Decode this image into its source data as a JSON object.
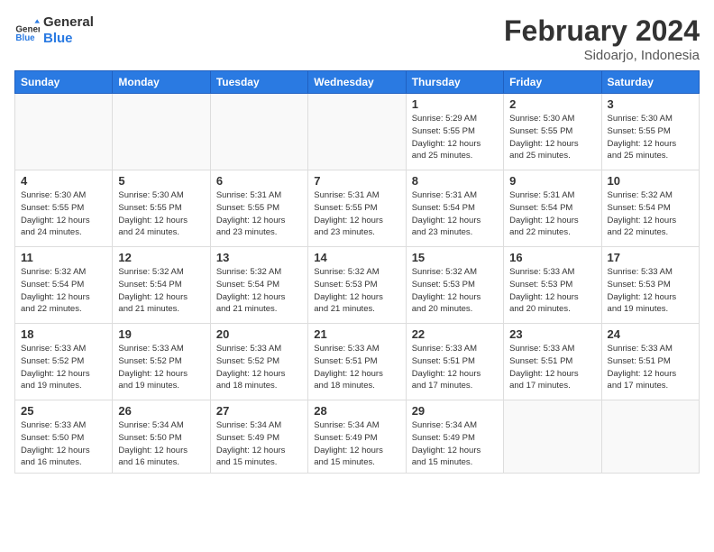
{
  "header": {
    "logo_line1": "General",
    "logo_line2": "Blue",
    "month_year": "February 2024",
    "location": "Sidoarjo, Indonesia"
  },
  "weekdays": [
    "Sunday",
    "Monday",
    "Tuesday",
    "Wednesday",
    "Thursday",
    "Friday",
    "Saturday"
  ],
  "weeks": [
    [
      {
        "day": "",
        "info": ""
      },
      {
        "day": "",
        "info": ""
      },
      {
        "day": "",
        "info": ""
      },
      {
        "day": "",
        "info": ""
      },
      {
        "day": "1",
        "info": "Sunrise: 5:29 AM\nSunset: 5:55 PM\nDaylight: 12 hours\nand 25 minutes."
      },
      {
        "day": "2",
        "info": "Sunrise: 5:30 AM\nSunset: 5:55 PM\nDaylight: 12 hours\nand 25 minutes."
      },
      {
        "day": "3",
        "info": "Sunrise: 5:30 AM\nSunset: 5:55 PM\nDaylight: 12 hours\nand 25 minutes."
      }
    ],
    [
      {
        "day": "4",
        "info": "Sunrise: 5:30 AM\nSunset: 5:55 PM\nDaylight: 12 hours\nand 24 minutes."
      },
      {
        "day": "5",
        "info": "Sunrise: 5:30 AM\nSunset: 5:55 PM\nDaylight: 12 hours\nand 24 minutes."
      },
      {
        "day": "6",
        "info": "Sunrise: 5:31 AM\nSunset: 5:55 PM\nDaylight: 12 hours\nand 23 minutes."
      },
      {
        "day": "7",
        "info": "Sunrise: 5:31 AM\nSunset: 5:55 PM\nDaylight: 12 hours\nand 23 minutes."
      },
      {
        "day": "8",
        "info": "Sunrise: 5:31 AM\nSunset: 5:54 PM\nDaylight: 12 hours\nand 23 minutes."
      },
      {
        "day": "9",
        "info": "Sunrise: 5:31 AM\nSunset: 5:54 PM\nDaylight: 12 hours\nand 22 minutes."
      },
      {
        "day": "10",
        "info": "Sunrise: 5:32 AM\nSunset: 5:54 PM\nDaylight: 12 hours\nand 22 minutes."
      }
    ],
    [
      {
        "day": "11",
        "info": "Sunrise: 5:32 AM\nSunset: 5:54 PM\nDaylight: 12 hours\nand 22 minutes."
      },
      {
        "day": "12",
        "info": "Sunrise: 5:32 AM\nSunset: 5:54 PM\nDaylight: 12 hours\nand 21 minutes."
      },
      {
        "day": "13",
        "info": "Sunrise: 5:32 AM\nSunset: 5:54 PM\nDaylight: 12 hours\nand 21 minutes."
      },
      {
        "day": "14",
        "info": "Sunrise: 5:32 AM\nSunset: 5:53 PM\nDaylight: 12 hours\nand 21 minutes."
      },
      {
        "day": "15",
        "info": "Sunrise: 5:32 AM\nSunset: 5:53 PM\nDaylight: 12 hours\nand 20 minutes."
      },
      {
        "day": "16",
        "info": "Sunrise: 5:33 AM\nSunset: 5:53 PM\nDaylight: 12 hours\nand 20 minutes."
      },
      {
        "day": "17",
        "info": "Sunrise: 5:33 AM\nSunset: 5:53 PM\nDaylight: 12 hours\nand 19 minutes."
      }
    ],
    [
      {
        "day": "18",
        "info": "Sunrise: 5:33 AM\nSunset: 5:52 PM\nDaylight: 12 hours\nand 19 minutes."
      },
      {
        "day": "19",
        "info": "Sunrise: 5:33 AM\nSunset: 5:52 PM\nDaylight: 12 hours\nand 19 minutes."
      },
      {
        "day": "20",
        "info": "Sunrise: 5:33 AM\nSunset: 5:52 PM\nDaylight: 12 hours\nand 18 minutes."
      },
      {
        "day": "21",
        "info": "Sunrise: 5:33 AM\nSunset: 5:51 PM\nDaylight: 12 hours\nand 18 minutes."
      },
      {
        "day": "22",
        "info": "Sunrise: 5:33 AM\nSunset: 5:51 PM\nDaylight: 12 hours\nand 17 minutes."
      },
      {
        "day": "23",
        "info": "Sunrise: 5:33 AM\nSunset: 5:51 PM\nDaylight: 12 hours\nand 17 minutes."
      },
      {
        "day": "24",
        "info": "Sunrise: 5:33 AM\nSunset: 5:51 PM\nDaylight: 12 hours\nand 17 minutes."
      }
    ],
    [
      {
        "day": "25",
        "info": "Sunrise: 5:33 AM\nSunset: 5:50 PM\nDaylight: 12 hours\nand 16 minutes."
      },
      {
        "day": "26",
        "info": "Sunrise: 5:34 AM\nSunset: 5:50 PM\nDaylight: 12 hours\nand 16 minutes."
      },
      {
        "day": "27",
        "info": "Sunrise: 5:34 AM\nSunset: 5:49 PM\nDaylight: 12 hours\nand 15 minutes."
      },
      {
        "day": "28",
        "info": "Sunrise: 5:34 AM\nSunset: 5:49 PM\nDaylight: 12 hours\nand 15 minutes."
      },
      {
        "day": "29",
        "info": "Sunrise: 5:34 AM\nSunset: 5:49 PM\nDaylight: 12 hours\nand 15 minutes."
      },
      {
        "day": "",
        "info": ""
      },
      {
        "day": "",
        "info": ""
      }
    ]
  ]
}
